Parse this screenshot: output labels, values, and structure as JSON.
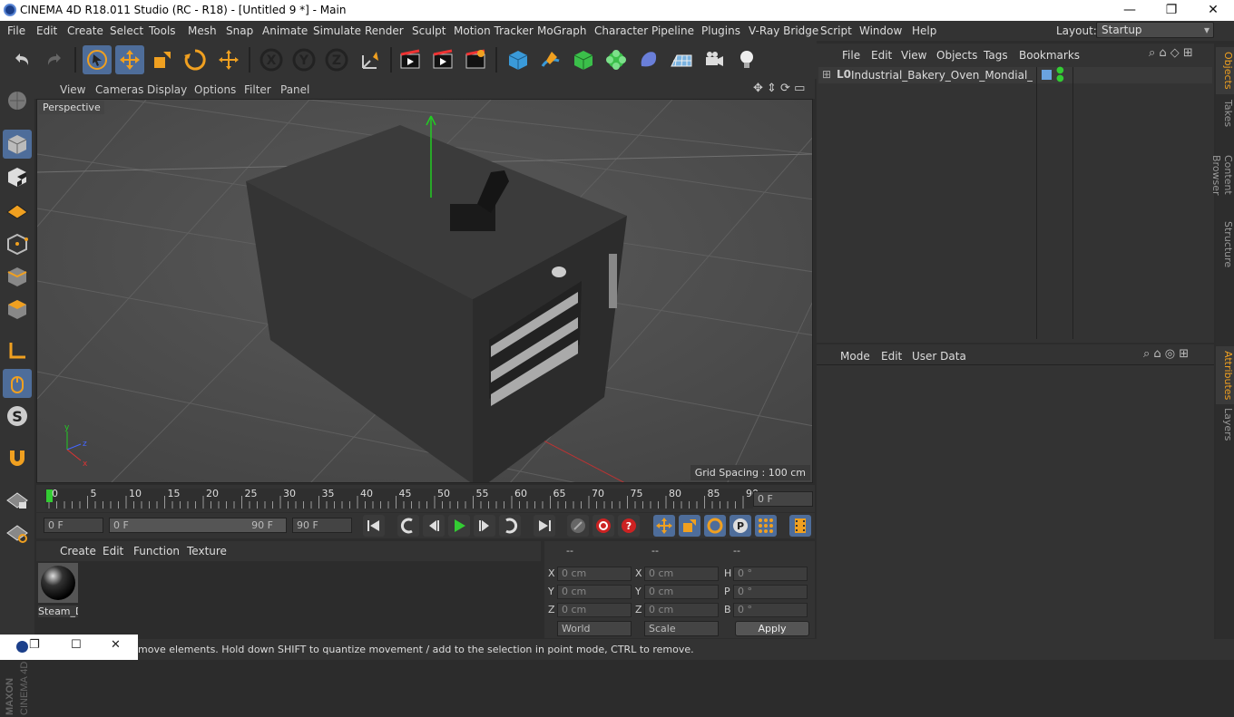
{
  "window": {
    "title": "CINEMA 4D R18.011 Studio (RC - R18) - [Untitled 9 *] - Main",
    "min": "—",
    "restore": "❐",
    "close": "✕"
  },
  "menu": {
    "items": [
      "File",
      "Edit",
      "Create",
      "Select",
      "Tools",
      "Mesh",
      "Snap",
      "Animate",
      "Simulate",
      "Render",
      "Sculpt",
      "Motion Tracker",
      "MoGraph",
      "Character",
      "Pipeline",
      "Plugins",
      "V-Ray Bridge",
      "Script",
      "Window",
      "Help"
    ],
    "layout_label": "Layout:",
    "layout_value": "Startup"
  },
  "viewport": {
    "menu": [
      "View",
      "Cameras",
      "Display",
      "Options",
      "Filter",
      "Panel"
    ],
    "label": "Perspective",
    "grid_spacing": "Grid Spacing : 100 cm"
  },
  "timeline": {
    "ticks": [
      "0",
      "5",
      "10",
      "15",
      "20",
      "25",
      "30",
      "35",
      "40",
      "45",
      "50",
      "55",
      "60",
      "65",
      "70",
      "75",
      "80",
      "85",
      "90"
    ],
    "current_frame": "0 F"
  },
  "controls": {
    "start": "0 F",
    "range_start": "0 F",
    "range_end": "90 F",
    "end": "90 F"
  },
  "materials": {
    "menu": [
      "Create",
      "Edit",
      "Function",
      "Texture"
    ],
    "items": [
      {
        "name": "Steam_D"
      }
    ]
  },
  "coordinates": {
    "headers": [
      "--",
      "--",
      "--"
    ],
    "rows": [
      {
        "a": "X",
        "av": "0 cm",
        "b": "X",
        "bv": "0 cm",
        "c": "H",
        "cv": "0 °"
      },
      {
        "a": "Y",
        "av": "0 cm",
        "b": "Y",
        "bv": "0 cm",
        "c": "P",
        "cv": "0 °"
      },
      {
        "a": "Z",
        "av": "0 cm",
        "b": "Z",
        "bv": "0 cm",
        "c": "B",
        "cv": "0 °"
      }
    ],
    "world": "World",
    "scale": "Scale",
    "apply": "Apply"
  },
  "objects": {
    "menu": [
      "File",
      "Edit",
      "View",
      "Objects",
      "Tags",
      "Bookmarks"
    ],
    "items": [
      {
        "name": "Industrial_Bakery_Oven_Mondial_Forni"
      }
    ]
  },
  "attributes": {
    "menu": [
      "Mode",
      "Edit",
      "User Data"
    ]
  },
  "right_tabs": [
    "Objects",
    "Takes",
    "Content Browser",
    "Structure",
    "Attributes",
    "Layers"
  ],
  "status": {
    "text": "move elements. Hold down SHIFT to quantize movement / add to the selection in point mode, CTRL to remove."
  },
  "brand": {
    "maxon": "MAXON",
    "c4d": "CINEMA 4D"
  },
  "colors": {
    "accent": "#4e6d9a",
    "orange": "#f0a020"
  }
}
